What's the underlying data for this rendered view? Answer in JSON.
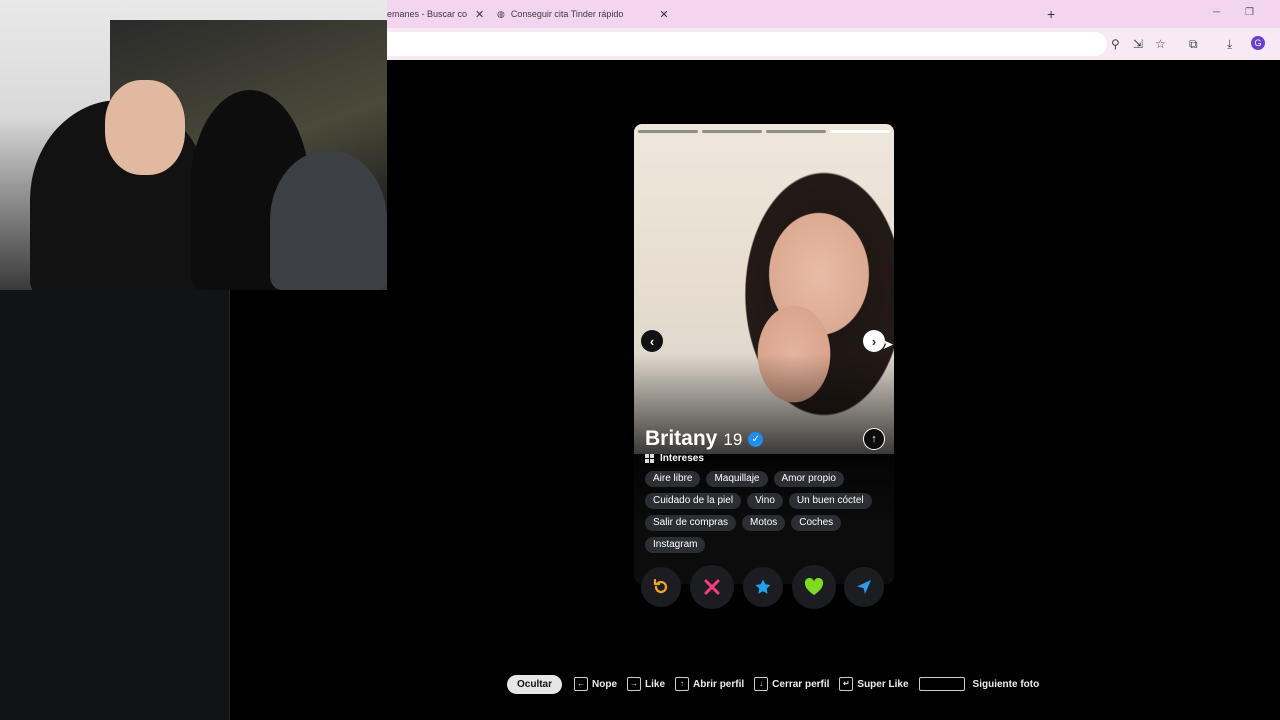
{
  "browser": {
    "tabs": [
      {
        "title": "emanes - Buscar co"
      },
      {
        "title": "Conseguir cita Tinder rápido"
      }
    ],
    "new_tab": "+",
    "window_controls": [
      "─",
      "❐"
    ],
    "avatar_letter": "G"
  },
  "profile": {
    "name": "Britany",
    "age": "19",
    "verified": true,
    "photo_count": 4,
    "active_photo_index": 3,
    "interests_title": "Intereses",
    "interests": [
      "Aire libre",
      "Maquillaje",
      "Amor propio",
      "Cuidado de la piel",
      "Vino",
      "Un buen cóctel",
      "Salir de compras",
      "Motos",
      "Coches",
      "Instagram"
    ]
  },
  "actions": {
    "rewind": {
      "icon": "rewind-icon",
      "color": "#f5a623"
    },
    "nope": {
      "icon": "x-icon",
      "color": "#ff3b7f"
    },
    "super_like": {
      "icon": "star-icon",
      "color": "#1ea1f2"
    },
    "like": {
      "icon": "heart-icon",
      "color": "#7ddc1f"
    },
    "boost": {
      "icon": "send-icon",
      "color": "#2a9bf5"
    }
  },
  "shortcuts": {
    "hide": "Ocultar",
    "items": [
      {
        "key": "←",
        "label": "Nope"
      },
      {
        "key": "→",
        "label": "Like"
      },
      {
        "key": "↑",
        "label": "Abrir perfil"
      },
      {
        "key": "↓",
        "label": "Cerrar perfil"
      },
      {
        "key": "↵",
        "label": "Super Like"
      },
      {
        "key": "",
        "label": "Siguiente foto"
      }
    ]
  }
}
